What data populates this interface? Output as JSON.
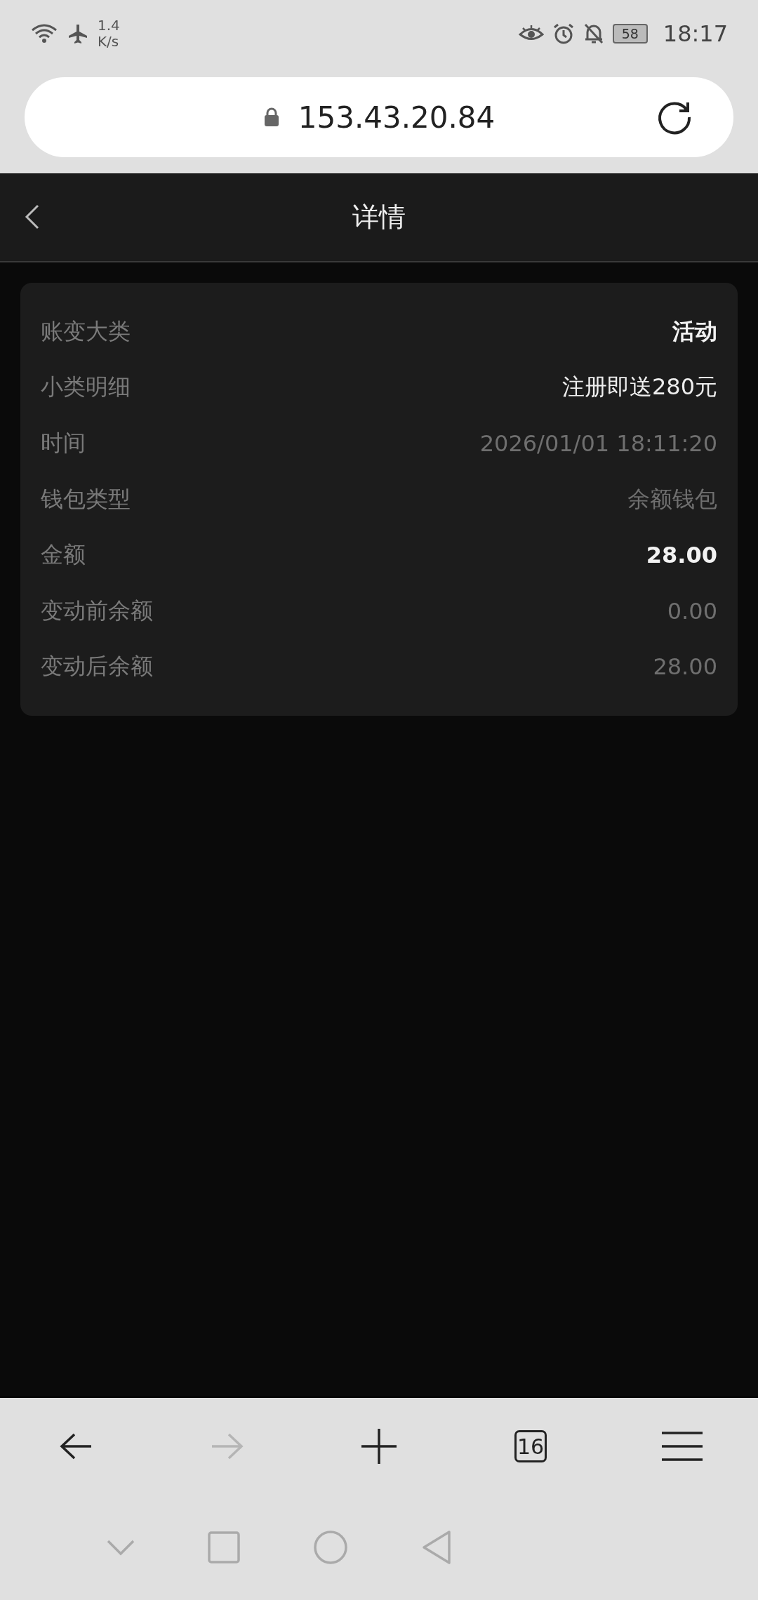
{
  "status_bar": {
    "speed_value": "1.4",
    "speed_unit": "K/s",
    "battery": "58",
    "time": "18:17"
  },
  "address_bar": {
    "url": "153.43.20.84"
  },
  "header": {
    "title": "详情"
  },
  "details": [
    {
      "label": "账变大类",
      "value": "活动",
      "kind": "strong"
    },
    {
      "label": "小类明细",
      "value": "注册即送280元",
      "kind": "normal"
    },
    {
      "label": "时间",
      "value": "2026/01/01 18:11:20",
      "kind": "muted"
    },
    {
      "label": "钱包类型",
      "value": "余额钱包",
      "kind": "muted"
    },
    {
      "label": "金额",
      "value": "28.00",
      "kind": "strong"
    },
    {
      "label": "变动前余额",
      "value": "0.00",
      "kind": "muted"
    },
    {
      "label": "变动后余额",
      "value": "28.00",
      "kind": "muted"
    }
  ],
  "browser_toolbar": [
    {
      "kind": "back",
      "disabled": false
    },
    {
      "kind": "forward",
      "disabled": true
    },
    {
      "kind": "new-tab",
      "disabled": false
    },
    {
      "kind": "tabs",
      "count": "16",
      "disabled": false
    },
    {
      "kind": "menu",
      "disabled": false
    }
  ]
}
